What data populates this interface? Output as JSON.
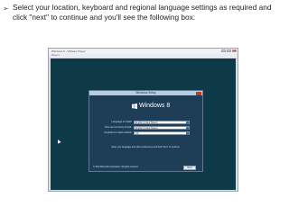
{
  "slide": {
    "bullet_icon": "arrow-bullet-icon",
    "bullet_glyph": "➢",
    "instruction": "Select your location, keyboard and regional language settings as required and click \"next\" to continue and you'll see the following box:"
  },
  "vm": {
    "title": "Windows 8 - VMware Player",
    "menu": "Player  ▾",
    "setup": {
      "title": "Windows Setup",
      "logo_icon": "windows-logo-icon",
      "product": "Windows 8",
      "fields": [
        {
          "label": "Language to install:",
          "value": "English (United States)"
        },
        {
          "label": "Time and currency format:",
          "value": "English (United States)"
        },
        {
          "label": "Keyboard or input method:",
          "value": "US"
        }
      ],
      "hint": "Enter your language and other preferences and click \"Next\" to continue.",
      "copyright": "© 2012 Microsoft Corporation. All rights reserved.",
      "next_label": "Next"
    },
    "cursor_icon": "mouse-cursor-icon"
  }
}
